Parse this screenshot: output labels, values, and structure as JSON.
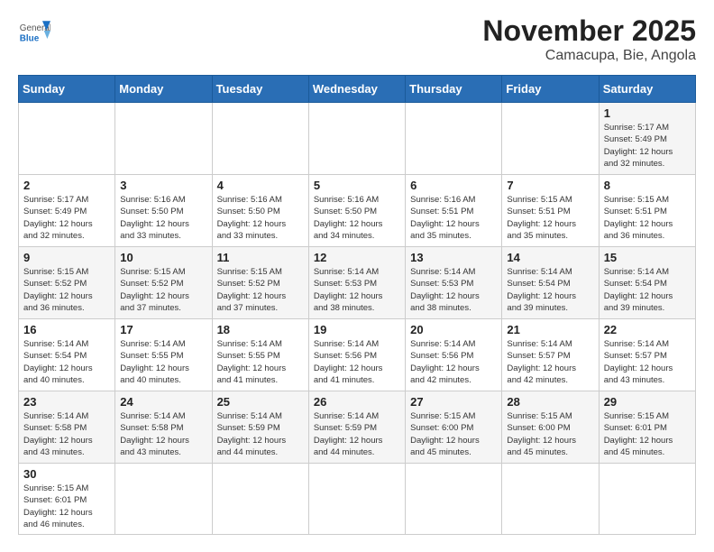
{
  "header": {
    "logo_general": "General",
    "logo_blue": "Blue",
    "title": "November 2025",
    "subtitle": "Camacupa, Bie, Angola"
  },
  "days_of_week": [
    "Sunday",
    "Monday",
    "Tuesday",
    "Wednesday",
    "Thursday",
    "Friday",
    "Saturday"
  ],
  "weeks": [
    [
      {
        "day": "",
        "info": ""
      },
      {
        "day": "",
        "info": ""
      },
      {
        "day": "",
        "info": ""
      },
      {
        "day": "",
        "info": ""
      },
      {
        "day": "",
        "info": ""
      },
      {
        "day": "",
        "info": ""
      },
      {
        "day": "1",
        "info": "Sunrise: 5:17 AM\nSunset: 5:49 PM\nDaylight: 12 hours\nand 32 minutes."
      }
    ],
    [
      {
        "day": "2",
        "info": "Sunrise: 5:17 AM\nSunset: 5:49 PM\nDaylight: 12 hours\nand 32 minutes."
      },
      {
        "day": "3",
        "info": "Sunrise: 5:16 AM\nSunset: 5:50 PM\nDaylight: 12 hours\nand 33 minutes."
      },
      {
        "day": "4",
        "info": "Sunrise: 5:16 AM\nSunset: 5:50 PM\nDaylight: 12 hours\nand 33 minutes."
      },
      {
        "day": "5",
        "info": "Sunrise: 5:16 AM\nSunset: 5:50 PM\nDaylight: 12 hours\nand 34 minutes."
      },
      {
        "day": "6",
        "info": "Sunrise: 5:16 AM\nSunset: 5:51 PM\nDaylight: 12 hours\nand 35 minutes."
      },
      {
        "day": "7",
        "info": "Sunrise: 5:15 AM\nSunset: 5:51 PM\nDaylight: 12 hours\nand 35 minutes."
      },
      {
        "day": "8",
        "info": "Sunrise: 5:15 AM\nSunset: 5:51 PM\nDaylight: 12 hours\nand 36 minutes."
      }
    ],
    [
      {
        "day": "9",
        "info": "Sunrise: 5:15 AM\nSunset: 5:52 PM\nDaylight: 12 hours\nand 36 minutes."
      },
      {
        "day": "10",
        "info": "Sunrise: 5:15 AM\nSunset: 5:52 PM\nDaylight: 12 hours\nand 37 minutes."
      },
      {
        "day": "11",
        "info": "Sunrise: 5:15 AM\nSunset: 5:52 PM\nDaylight: 12 hours\nand 37 minutes."
      },
      {
        "day": "12",
        "info": "Sunrise: 5:14 AM\nSunset: 5:53 PM\nDaylight: 12 hours\nand 38 minutes."
      },
      {
        "day": "13",
        "info": "Sunrise: 5:14 AM\nSunset: 5:53 PM\nDaylight: 12 hours\nand 38 minutes."
      },
      {
        "day": "14",
        "info": "Sunrise: 5:14 AM\nSunset: 5:54 PM\nDaylight: 12 hours\nand 39 minutes."
      },
      {
        "day": "15",
        "info": "Sunrise: 5:14 AM\nSunset: 5:54 PM\nDaylight: 12 hours\nand 39 minutes."
      }
    ],
    [
      {
        "day": "16",
        "info": "Sunrise: 5:14 AM\nSunset: 5:54 PM\nDaylight: 12 hours\nand 40 minutes."
      },
      {
        "day": "17",
        "info": "Sunrise: 5:14 AM\nSunset: 5:55 PM\nDaylight: 12 hours\nand 40 minutes."
      },
      {
        "day": "18",
        "info": "Sunrise: 5:14 AM\nSunset: 5:55 PM\nDaylight: 12 hours\nand 41 minutes."
      },
      {
        "day": "19",
        "info": "Sunrise: 5:14 AM\nSunset: 5:56 PM\nDaylight: 12 hours\nand 41 minutes."
      },
      {
        "day": "20",
        "info": "Sunrise: 5:14 AM\nSunset: 5:56 PM\nDaylight: 12 hours\nand 42 minutes."
      },
      {
        "day": "21",
        "info": "Sunrise: 5:14 AM\nSunset: 5:57 PM\nDaylight: 12 hours\nand 42 minutes."
      },
      {
        "day": "22",
        "info": "Sunrise: 5:14 AM\nSunset: 5:57 PM\nDaylight: 12 hours\nand 43 minutes."
      }
    ],
    [
      {
        "day": "23",
        "info": "Sunrise: 5:14 AM\nSunset: 5:58 PM\nDaylight: 12 hours\nand 43 minutes."
      },
      {
        "day": "24",
        "info": "Sunrise: 5:14 AM\nSunset: 5:58 PM\nDaylight: 12 hours\nand 43 minutes."
      },
      {
        "day": "25",
        "info": "Sunrise: 5:14 AM\nSunset: 5:59 PM\nDaylight: 12 hours\nand 44 minutes."
      },
      {
        "day": "26",
        "info": "Sunrise: 5:14 AM\nSunset: 5:59 PM\nDaylight: 12 hours\nand 44 minutes."
      },
      {
        "day": "27",
        "info": "Sunrise: 5:15 AM\nSunset: 6:00 PM\nDaylight: 12 hours\nand 45 minutes."
      },
      {
        "day": "28",
        "info": "Sunrise: 5:15 AM\nSunset: 6:00 PM\nDaylight: 12 hours\nand 45 minutes."
      },
      {
        "day": "29",
        "info": "Sunrise: 5:15 AM\nSunset: 6:01 PM\nDaylight: 12 hours\nand 45 minutes."
      }
    ],
    [
      {
        "day": "30",
        "info": "Sunrise: 5:15 AM\nSunset: 6:01 PM\nDaylight: 12 hours\nand 46 minutes."
      },
      {
        "day": "",
        "info": ""
      },
      {
        "day": "",
        "info": ""
      },
      {
        "day": "",
        "info": ""
      },
      {
        "day": "",
        "info": ""
      },
      {
        "day": "",
        "info": ""
      },
      {
        "day": "",
        "info": ""
      }
    ]
  ]
}
